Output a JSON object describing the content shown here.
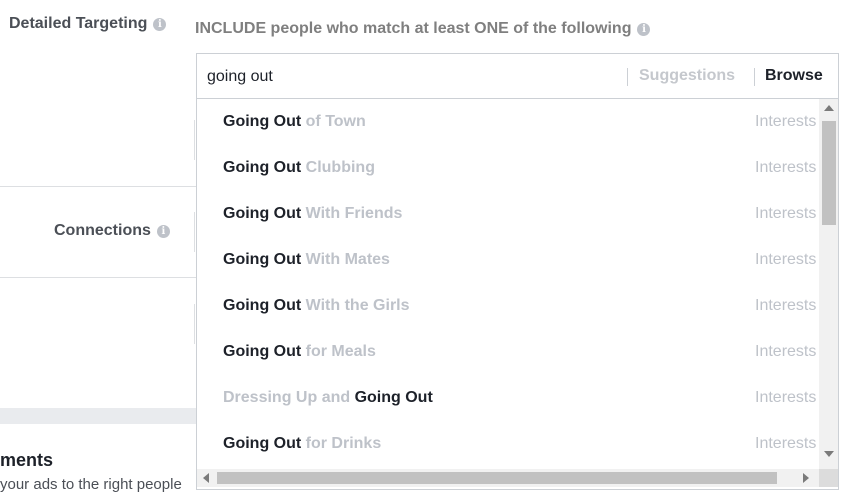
{
  "detailed_targeting": {
    "label": "Detailed Targeting",
    "info_icon": "i",
    "include_text": "INCLUDE people who match at least ONE of the following",
    "search": {
      "value": "going out"
    },
    "tabs": {
      "suggestions": "Suggestions",
      "browse": "Browse"
    },
    "results": [
      {
        "highlight": "Going Out",
        "rest": " of Town",
        "type": "Interests"
      },
      {
        "highlight": "Going Out",
        "rest": " Clubbing",
        "type": "Interests"
      },
      {
        "highlight": "Going Out",
        "rest": " With Friends",
        "type": "Interests"
      },
      {
        "highlight": "Going Out",
        "rest": " With Mates",
        "type": "Interests"
      },
      {
        "highlight": "Going Out",
        "rest": " With the Girls",
        "type": "Interests"
      },
      {
        "highlight": "Going Out",
        "rest": " for Meals",
        "type": "Interests"
      },
      {
        "prefix": "Dressing Up and ",
        "highlight": "Going Out",
        "type": "Interests"
      },
      {
        "highlight": "Going Out",
        "rest": " for Drinks",
        "type": "Interests"
      }
    ]
  },
  "connections": {
    "label": "Connections",
    "info_icon": "i"
  },
  "placements": {
    "title": "ments",
    "desc": "your ads to the right people"
  },
  "colors": {
    "highlight": "#1d2129",
    "muted": "#bec2c9",
    "label": "#4b4f56",
    "border": "#ccd0d5"
  }
}
